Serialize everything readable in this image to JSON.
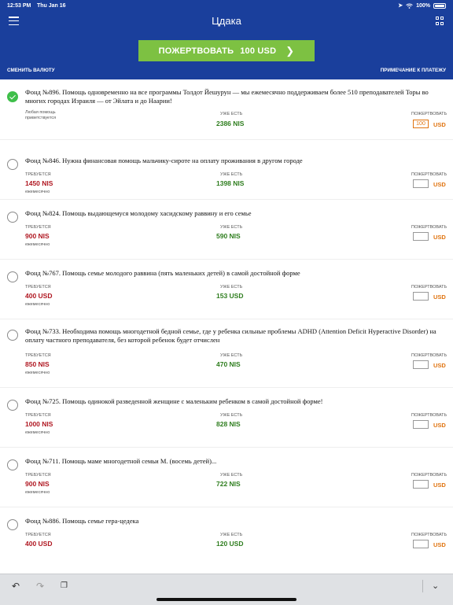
{
  "status_bar": {
    "time": "12:53 PM",
    "date": "Thu Jan 16",
    "battery": "100%"
  },
  "header": {
    "title": "Цдака",
    "donate_button": {
      "label": "ПОЖЕРТВОВАТЬ",
      "amount": "100 USD"
    },
    "change_currency": "СМЕНИТЬ ВАЛЮТУ",
    "payment_note": "ПРИМЕЧАНИЕ К ПЛАТЕЖУ"
  },
  "labels": {
    "required": "ТРЕБУЕТСЯ",
    "already": "УЖЕ ЕСТЬ",
    "donate": "ПОЖЕРТВОВАТЬ",
    "monthly": "ежемесячно",
    "any_help_line1": "Любая помощь",
    "any_help_line2": "приветствуется"
  },
  "funds": [
    {
      "title": "Фонд №896. Помощь одновременно на все программы Толдот Йешурун — мы ежемесячно поддерживаем более 510 преподавателей Торы во многих городах Израиля — от Эйлата и до Наарии!",
      "required": "",
      "monthly": false,
      "already": "2386 NIS",
      "donation": "100",
      "currency": "USD",
      "checked": true
    },
    {
      "title": "Фонд №846. Нужна финансовая помощь мальчику-сироте на оплату проживания в другом городе",
      "required": "1450 NIS",
      "monthly": true,
      "already": "1398 NIS",
      "donation": "",
      "currency": "USD",
      "checked": false
    },
    {
      "title": "Фонд №824. Помощь выдающемуся молодому хасидскому раввину и его семье",
      "required": "900 NIS",
      "monthly": true,
      "already": "590 NIS",
      "donation": "",
      "currency": "USD",
      "checked": false
    },
    {
      "title": "Фонд №767. Помощь семье молодого раввина (пять маленьких детей) в самой достойной форме",
      "required": "400 USD",
      "monthly": true,
      "already": "153 USD",
      "donation": "",
      "currency": "USD",
      "checked": false
    },
    {
      "title": "Фонд №733. Необходима помощь многодетной бедной семье, где у ребенка сильные проблемы ADHD (Attention Deficit Hyperactive Disorder) на оплату частного преподавателя, без которой ребенок будет отчислен",
      "required": "850 NIS",
      "monthly": true,
      "already": "470 NIS",
      "donation": "",
      "currency": "USD",
      "checked": false
    },
    {
      "title": "Фонд №725. Помощь одинокой разведенной женщине с маленьким ребенком в самой достойной форме!",
      "required": "1000 NIS",
      "monthly": true,
      "already": "828 NIS",
      "donation": "",
      "currency": "USD",
      "checked": false
    },
    {
      "title": "Фонд №711. Помощь маме многодетной семьи М. (восемь детей)...",
      "required": "900 NIS",
      "monthly": true,
      "already": "722 NIS",
      "donation": "",
      "currency": "USD",
      "checked": false
    },
    {
      "title": "Фонд №886. Помощь семье гера-цедека",
      "required": "400 USD",
      "monthly": false,
      "already": "120 USD",
      "donation": "",
      "currency": "USD",
      "checked": false
    }
  ],
  "icons": [
    "menu-icon",
    "grid-icon",
    "wifi-icon",
    "battery-icon",
    "chevron-right-icon",
    "undo-icon",
    "redo-icon",
    "clipboard-icon",
    "chevron-down-icon"
  ],
  "colors": {
    "header": "#1a3f9c",
    "donate_button": "#7dc142",
    "required": "#b01822",
    "already": "#2e7d1e",
    "currency": "#e07410",
    "check": "#3fbf4a"
  }
}
